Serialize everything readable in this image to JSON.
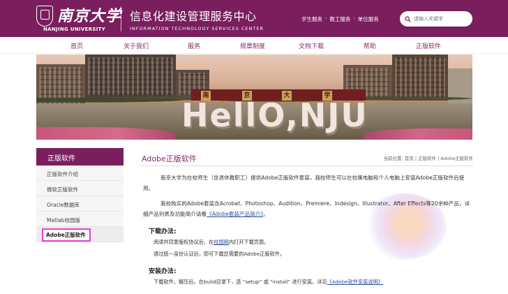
{
  "header": {
    "university_cn": "南京大学",
    "university_en": "NANJING UNIVERSITY",
    "site_cn": "信息化建设管理服务中心",
    "site_en": "INFORMATION TECHNOLOGY SERVICES CENTER",
    "quick_links": [
      "学生服务",
      "·",
      "教工服务",
      "·",
      "单位服务"
    ],
    "search_placeholder": "请输入关键字",
    "brand_color": "#7a1e5e"
  },
  "nav": {
    "items": [
      "首页",
      "关于我们",
      "服务",
      "规章制度",
      "文档下载",
      "帮助",
      "正版软件"
    ]
  },
  "banner": {
    "sign_chars": [
      "南",
      "京",
      "大",
      "学"
    ],
    "headline": "HellO,NJU"
  },
  "sidebar": {
    "title": "正版软件",
    "items": [
      "正版软件介绍",
      "微软正版软件",
      "Oracle数据库",
      "Matlab校园版",
      "Adobe正版软件"
    ],
    "active_index": 4
  },
  "main": {
    "title": "Adobe正版软件",
    "breadcrumb": "当前位置: 首页 | 正版软件 | Adobe正版软件",
    "intro_1": "南京大学为在校师生（含退休教职工）提供Adobe正版软件套装，我校师生可以在校属电脑和个人电脑上安装Adobe正版软件后使用。",
    "intro_2_prefix": "我校购买的Adobe套装含Acrobat、Photoshop、Audition、Premiere、Indesign、Illustrator、After Effects等20余种产品，详细产品列表及功能简介请看",
    "intro_2_link": "《Adobe套装产品简介》",
    "intro_2_suffix": "。",
    "download_heading": "下载办法:",
    "download_step_1_prefix": "阅读并同意版权协议后，在",
    "download_step_1_link": "校园网",
    "download_step_1_suffix": "内打开下载页面。",
    "download_step_2": "通过统一身份认证后，即可下载您需要的Adobe正版软件。",
    "install_heading": "安装办法:",
    "install_step_prefix": "下载软件，解压后，在bulid目录下，选 “setup” 或 “install” 进行安装。详见",
    "install_step_link": "《Adobe软件安装说明》"
  }
}
